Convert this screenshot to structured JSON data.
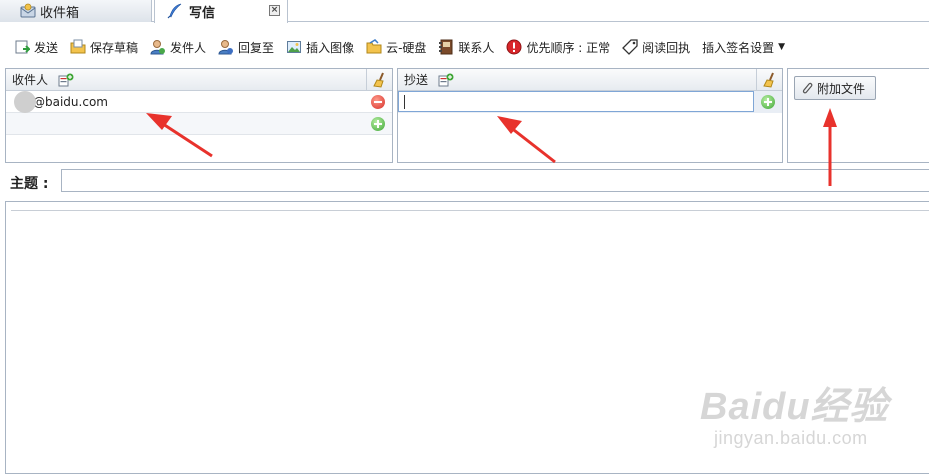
{
  "tabs": [
    {
      "label": "收件箱",
      "icon": "inbox-icon"
    },
    {
      "label": "写信",
      "icon": "quill-icon",
      "close": "×"
    }
  ],
  "toolbar": {
    "send": "发送",
    "save_draft": "保存草稿",
    "sender": "发件人",
    "reply_to": "回复至",
    "insert_image": "插入图像",
    "cloud_drive": "云-硬盘",
    "contacts": "联系人",
    "priority": "优先顺序 : 正常",
    "read_receipt": "阅读回执",
    "insert_signature": "插入签名设置"
  },
  "to": {
    "label": "收件人",
    "recipient": "@baidu.com"
  },
  "cc": {
    "label": "抄送",
    "value": ""
  },
  "attach": {
    "label": "附加文件"
  },
  "subject": {
    "label": "主题 :",
    "value": ""
  },
  "watermark": {
    "main": "Baidu经验",
    "sub": "jingyan.baidu.com"
  },
  "colors": {
    "arrow": "#e8322c",
    "border": "#a8b4c3",
    "header_bg": "#e7ebf0"
  }
}
